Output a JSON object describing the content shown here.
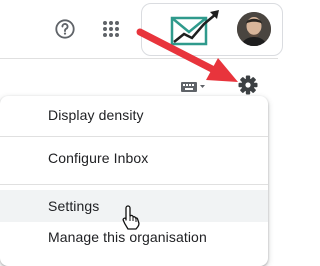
{
  "header": {
    "help_icon": "help-circle-icon",
    "apps_icon": "apps-grid-icon",
    "account_logo": "trend-chart-logo",
    "avatar": "user-avatar"
  },
  "toolbar": {
    "keyboard_icon": "keyboard-icon",
    "settings_icon": "gear-icon"
  },
  "menu": {
    "items": [
      {
        "label": "Display density"
      },
      {
        "label": "Configure Inbox"
      },
      {
        "label": "Settings",
        "hovered": true
      },
      {
        "label": "Manage this organisation"
      }
    ]
  },
  "colors": {
    "annotation_arrow": "#e8343c",
    "logo_teal": "#2f9a8c",
    "hover_bg": "#f1f3f4"
  }
}
